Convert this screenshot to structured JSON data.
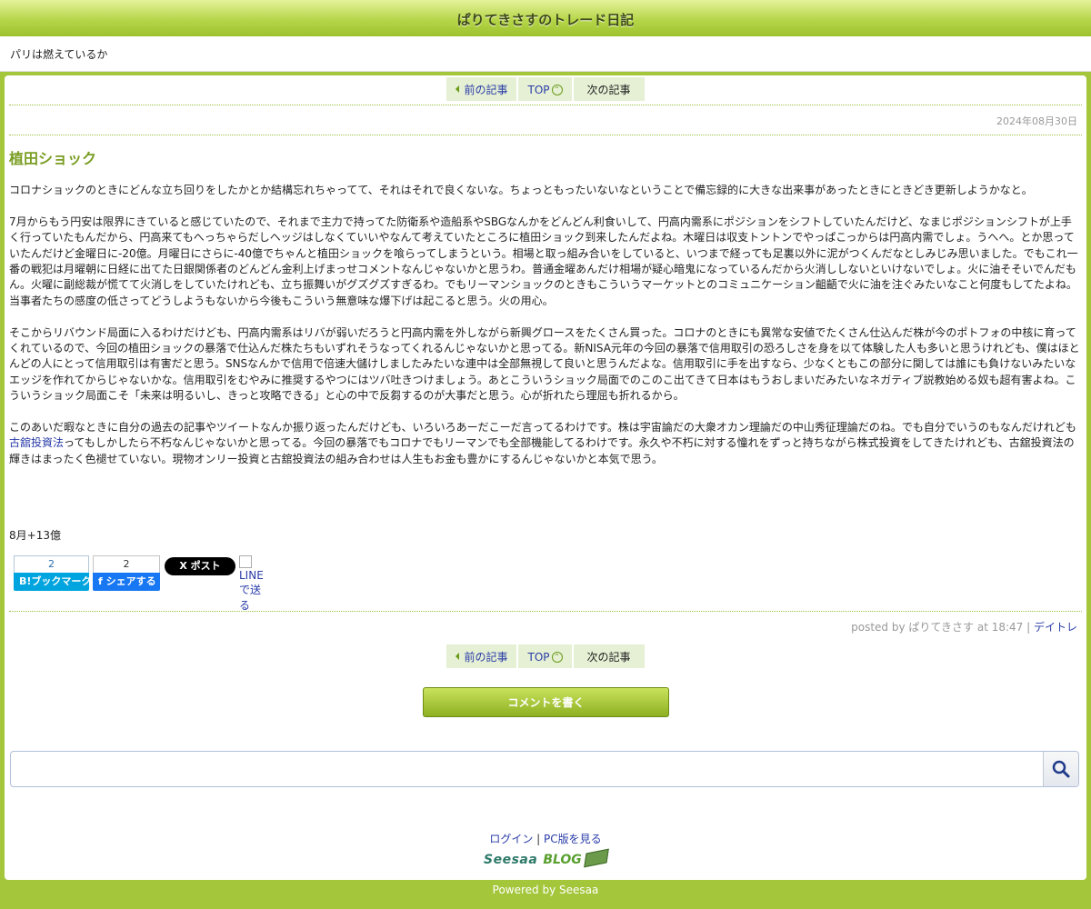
{
  "site": {
    "title": "ぱりてきさすのトレード日記",
    "subtitle": "パリは燃えているか"
  },
  "nav": {
    "prev_label": "前の記事",
    "top_label": "TOP",
    "next_label": "次の記事"
  },
  "article": {
    "date": "2024年08月30日",
    "title": "植田ショック",
    "paragraphs": [
      "コロナショックのときにどんな立ち回りをしたかとか結構忘れちゃってて、それはそれで良くないな。ちょっともったいないなということで備忘録的に大きな出来事があったときにときどき更新しようかなと。",
      "7月からもう円安は限界にきていると感じていたので、それまで主力で持ってた防衛系や造船系やSBGなんかをどんどん利食いして、円高内需系にポジションをシフトしていたんだけど、なまじポジションシフトが上手く行っていたもんだから、円高来てもへっちゃらだしヘッジはしなくていいやなんて考えていたところに植田ショック到来したんだよね。木曜日は収支トントンでやっぱこっからは円高内需でしょ。うへへ。とか思っていたんだけど金曜日に-20億。月曜日にさらに-40億でちゃんと植田ショックを喰らってしまうという。相場と取っ組み合いをしていると、いつまで経っても足裏以外に泥がつくんだなとしみじみ思いました。でもこれ一番の戦犯は月曜朝に日経に出てた日銀関係者のどんどん金利上げまっせコメントなんじゃないかと思うわ。普通金曜あんだけ相場が疑心暗鬼になっているんだから火消ししないといけないでしょ。火に油そそいでんだもん。火曜に副総裁が慌てて火消しをしていたけれども、立ち振舞いがグズグズすぎるわ。でもリーマンショックのときもこういうマーケットとのコミュニケーション齟齬で火に油を注ぐみたいなこと何度もしてたよね。当事者たちの感度の低さってどうしようもないから今後もこういう無意味な爆下げは起こると思う。火の用心。",
      "そこからリバウンド局面に入るわけだけども、円高内需系はリバが弱いだろうと円高内需を外しながら新興グロースをたくさん買った。コロナのときにも異常な安値でたくさん仕込んだ株が今のポトフォの中核に育ってくれているので、今回の植田ショックの暴落で仕込んだ株たちもいずれそうなってくれるんじゃないかと思ってる。新NISA元年の今回の暴落で信用取引の恐ろしさを身を以て体験した人も多いと思うけれども、僕はほとんどの人にとって信用取引は有害だと思う。SNSなんかで信用で倍速大儲けしましたみたいな連中は全部無視して良いと思うんだよな。信用取引に手を出すなら、少なくともこの部分に関しては誰にも負けないみたいなエッジを作れてからじゃないかな。信用取引をむやみに推奨するやつにはツバ吐きつけましょう。あとこういうショック局面でのこのこ出てきて日本はもうおしまいだみたいなネガティブ説教始める奴も超有害よね。こういうショック局面こそ「未来は明るいし、きっと攻略できる」と心の中で反芻するのが大事だと思う。心が折れたら理屈も折れるから。"
    ],
    "p4_before": "このあいだ暇なときに自分の過去の記事やツイートなんか振り返ったんだけども、いろいろあーだこーだ言ってるわけです。株は宇宙論だの大衆オカン理論だの中山秀征理論だのね。でも自分でいうのもなんだけれども",
    "p4_link": "古舘投資法",
    "p4_after": "ってもしかしたら不朽なんじゃないかと思ってる。今回の暴落でもコロナでもリーマンでも全部機能してるわけです。永久や不朽に対する憧れをずっと持ちながら株式投資をしてきたけれども、古舘投資法の輝きはまったく色褪せていない。現物オンリー投資と古舘投資法の組み合わせは人生もお金も豊かにするんじゃないかと本気で思う。",
    "profit_line": "8月+13億"
  },
  "share": {
    "hatena_count": "2",
    "hatena_label": "B!ブックマーク",
    "fb_count": "2",
    "fb_label": "f シェアする",
    "x_label": "X ポスト",
    "line_label": "LINEで送る"
  },
  "meta": {
    "posted_by_prefix": "posted by ぱりてきさす at 18:47 | ",
    "category": "デイトレ"
  },
  "comment_button": "コメントを書く",
  "search": {
    "placeholder": "",
    "icon": "search-icon"
  },
  "footer": {
    "login": "ログイン",
    "separator": " | ",
    "pc_view": "PC版を見る",
    "logo_seesaa": "Seesaa",
    "logo_blog": "BLOG",
    "powered": "Powered by Seesaa"
  },
  "colors": {
    "accent": "#a4c63a",
    "link": "#2a3ca8",
    "title_green": "#7a9e24"
  }
}
